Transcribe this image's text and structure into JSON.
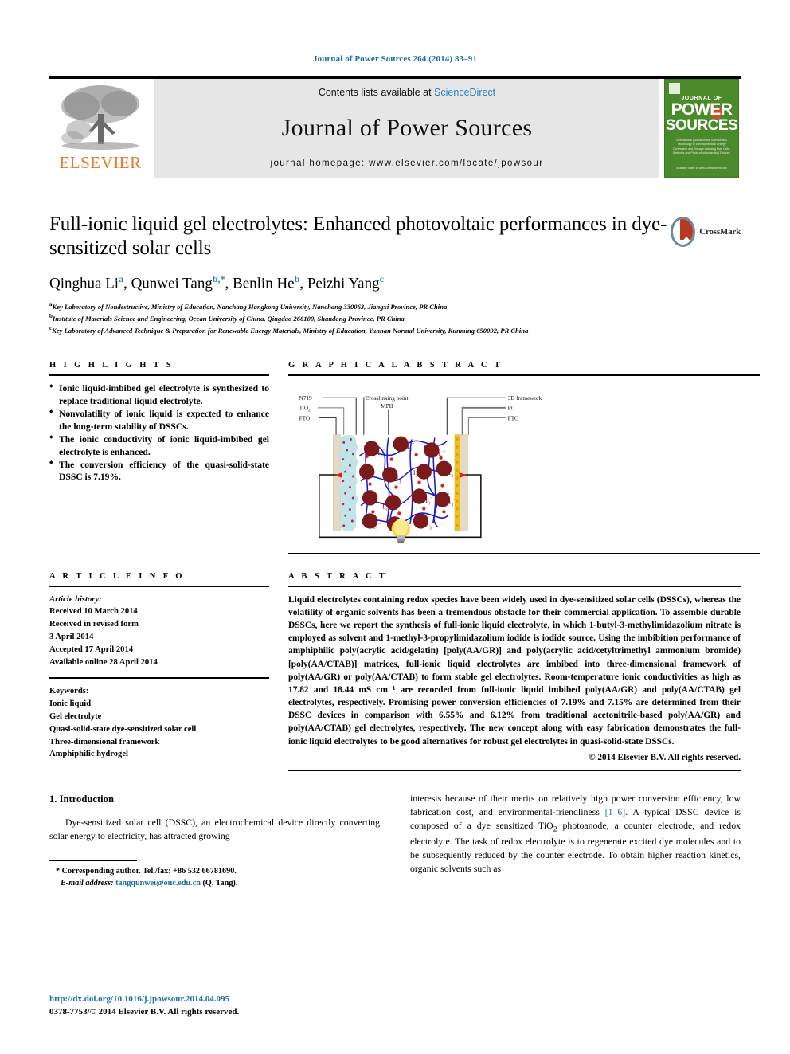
{
  "runhead": "Journal of Power Sources 264 (2014) 83–91",
  "masthead": {
    "publisher": "ELSEVIER",
    "contents_prefix": "Contents lists available at ",
    "contents_link": "ScienceDirect",
    "journal_name": "Journal of Power Sources",
    "homepage": "journal homepage: www.elsevier.com/locate/jpowsour",
    "cover": {
      "journal_of": "JOURNAL OF",
      "power": "POWER",
      "sources": "SOURCES",
      "blurb": "International journal on the Science and Technology of Electrochemical Energy Conversion and Storage including Fuel Cells, Batteries and Photo-electrochemical Devices",
      "footer": "Available online at www.sciencedirect.com"
    }
  },
  "article": {
    "title": "Full-ionic liquid gel electrolytes: Enhanced photovoltaic performances in dye-sensitized solar cells",
    "crossmark_label": "CrossMark",
    "authors": [
      {
        "name": "Qinghua Li",
        "marks": "a"
      },
      {
        "name": "Qunwei Tang",
        "marks": "b,*"
      },
      {
        "name": "Benlin He",
        "marks": "b"
      },
      {
        "name": "Peizhi Yang",
        "marks": "c"
      }
    ],
    "affiliations": [
      {
        "mark": "a",
        "text": "Key Laboratory of Nondestructive, Ministry of Education, Nanchang Hangkong University, Nanchang 330063, Jiangxi Province, PR China"
      },
      {
        "mark": "b",
        "text": "Institute of Materials Science and Engineering, Ocean University of China, Qingdao 266100, Shandong Province, PR China"
      },
      {
        "mark": "c",
        "text": "Key Laboratory of Advanced Technique & Preparation for Renewable Energy Materials, Ministry of Education, Yunnan Normal University, Kunming 650092, PR China"
      }
    ]
  },
  "highlights": {
    "heading": "H I G H L I G H T S",
    "items": [
      "Ionic liquid-imbibed gel electrolyte is synthesized to replace traditional liquid electrolyte.",
      "Nonvolatility of ionic liquid is expected to enhance the long-term stability of DSSCs.",
      "The ionic conductivity of ionic liquid-imbibed gel electrolyte is enhanced.",
      "The conversion efficiency of the quasi-solid-state DSSC is 7.19%."
    ]
  },
  "graphical_abstract": {
    "heading": "G R A P H I C A L   A B S T R A C T",
    "labels": {
      "n719": "N719",
      "tio2": "TiO",
      "tio2_sub": "2",
      "fto_left": "FTO",
      "crosslinking": "Crosslinking point",
      "mpii": "MPII",
      "framework": "3D framework",
      "pt": "Pt",
      "fto_right": "FTO",
      "ion_label": "I",
      "ion_sub": "3",
      "ion_sup": "−"
    }
  },
  "article_info": {
    "heading": "A R T I C L E   I N F O",
    "history_label": "Article history:",
    "history": [
      "Received 10 March 2014",
      "Received in revised form",
      "3 April 2014",
      "Accepted 17 April 2014",
      "Available online 28 April 2014"
    ],
    "keywords_label": "Keywords:",
    "keywords": [
      "Ionic liquid",
      "Gel electrolyte",
      "Quasi-solid-state dye-sensitized solar cell",
      "Three-dimensional framework",
      "Amphiphilic hydrogel"
    ]
  },
  "abstract": {
    "heading": "A B S T R A C T",
    "text": "Liquid electrolytes containing redox species have been widely used in dye-sensitized solar cells (DSSCs), whereas the volatility of organic solvents has been a tremendous obstacle for their commercial application. To assemble durable DSSCs, here we report the synthesis of full-ionic liquid electrolyte, in which 1-butyl-3-methylimidazolium nitrate is employed as solvent and 1-methyl-3-propylimidazolium iodide is iodide source. Using the imbibition performance of amphiphilic poly(acrylic acid/gelatin) [poly(AA/GR)] and poly(acrylic acid/cetyltrimethyl ammonium bromide) [poly(AA/CTAB)] matrices, full-ionic liquid electrolytes are imbibed into three-dimensional framework of poly(AA/GR) or poly(AA/CTAB) to form stable gel electrolytes. Room-temperature ionic conductivities as high as 17.82 and 18.44 mS cm⁻¹ are recorded from full-ionic liquid imbibed poly(AA/GR) and poly(AA/CTAB) gel electrolytes, respectively. Promising power conversion efficiencies of 7.19% and 7.15% are determined from their DSSC devices in comparison with 6.55% and 6.12% from traditional acetonitrile-based poly(AA/GR) and poly(AA/CTAB) gel electrolytes, respectively. The new concept along with easy fabrication demonstrates the full-ionic liquid electrolytes to be good alternatives for robust gel electrolytes in quasi-solid-state DSSCs.",
    "copyright": "© 2014 Elsevier B.V. All rights reserved."
  },
  "body": {
    "section_title": "1.  Introduction",
    "left_paragraph": "Dye-sensitized solar cell (DSSC), an electrochemical device directly converting solar energy to electricity, has attracted growing",
    "right_paragraph_1": "interests because of their merits on relatively high power conversion efficiency, low fabrication cost, and environmental-friendliness ",
    "right_ref": "[1–6]",
    "right_paragraph_2": ". A typical DSSC device is composed of a dye sensitized TiO",
    "right_sub": "2",
    "right_paragraph_3": " photoanode, a counter electrode, and redox electrolyte. The task of redox electrolyte is to regenerate excited dye molecules and to be subsequently reduced by the counter electrode. To obtain higher reaction kinetics, organic solvents such as"
  },
  "footnote": {
    "corresponding": "* Corresponding author. Tel./fax: +86 532 66781690.",
    "email_label": "E-mail address:",
    "email": "tangqunwei@ouc.edu.cn",
    "email_suffix": " (Q. Tang)."
  },
  "bottom": {
    "doi": "http://dx.doi.org/10.1016/j.jpowsour.2014.04.095",
    "issn": "0378-7753/© 2014 Elsevier B.V. All rights reserved."
  },
  "colors": {
    "link_blue": "#1a6ea8",
    "elsevier_orange": "#E87722",
    "cover_green": "#4a8a2a",
    "ion_red": "#7b1a1a",
    "network_blue": "#1a1ad6",
    "tio2_cyan": "#bfe3e6",
    "pt_gold": "#f0c020"
  }
}
